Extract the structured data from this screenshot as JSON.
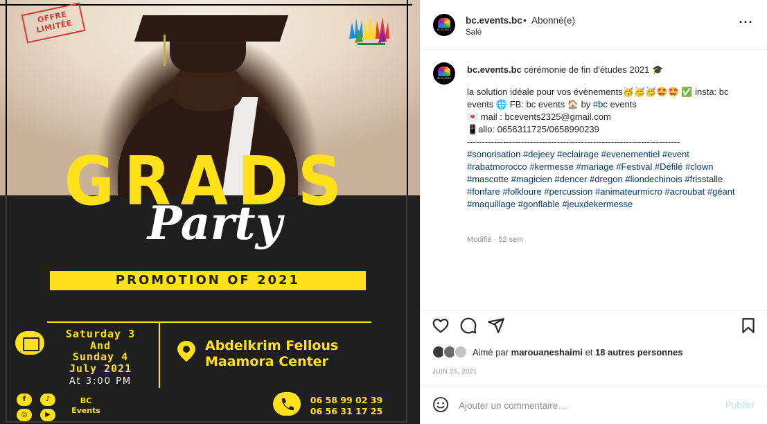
{
  "poster": {
    "offer": [
      "OFFRE",
      "LIMITÉE"
    ],
    "headline": "GRADS",
    "subheadline": "Party",
    "promotion": "PROMOTION OF  2021",
    "date_lines": [
      "Saturday 3",
      "And",
      "Sunday 4",
      "July 2021"
    ],
    "time": "At 3:00 PM",
    "venue_lines": [
      "Abdelkrim Fellous",
      "Maamora Center"
    ],
    "brand_lines": [
      "BC",
      "Events"
    ],
    "phones": [
      "06 58 99 02 39",
      "06 56 31 17 25"
    ],
    "social_icons": [
      "facebook-icon",
      "tiktok-icon",
      "instagram-icon",
      "youtube-icon"
    ],
    "colors": {
      "accent": "#ffe11a",
      "dark": "#1f1f1f",
      "stamp": "#d23a3a"
    }
  },
  "header": {
    "username": "bc.events.bc",
    "separator": "•",
    "follow_status": "Abonné(e)",
    "location": "Salé"
  },
  "caption": {
    "username": "bc.events.bc",
    "title": "cérémonie de fin d'études 2021 🎓",
    "line1": "la solution idéale pour vos évènements🥳🥳🥳🤩🤩 ✅ insta: bc events 🌐 FB: bc events 🏠 by ",
    "line1_tag": "#bc",
    "line1_end": " events",
    "line2": "💌 mail : bcevents2325@gmail.com",
    "line3": "📱allo: 0656311725/0658990239",
    "separator": "-----------------------------------------------------------------------",
    "hashtags": "#sonorisation #dejeey #eclairage #evenementiel #event #rabatmorocco #kermesse #mariage #Festival #Défilé #clown #mascotte #magicien #dencer #dregon #liondechinois #frisstalle #fonfare #folkloure #percussion #animateurmicro #acroubat #géant #maquillage #gonflable #jeuxdekermesse",
    "meta": "Modifié · 52 sem"
  },
  "likes": {
    "prefix": "Aimé par ",
    "user": "marouaneshaimi",
    "middle": " et ",
    "others": "18 autres personnes"
  },
  "post_date": "JUIN 25, 2021",
  "comment": {
    "placeholder": "Ajouter un commentaire…",
    "publish": "Publier"
  },
  "colors": {
    "link": "#00376b",
    "muted": "#8e8e8e",
    "publish": "#b2dffc"
  }
}
